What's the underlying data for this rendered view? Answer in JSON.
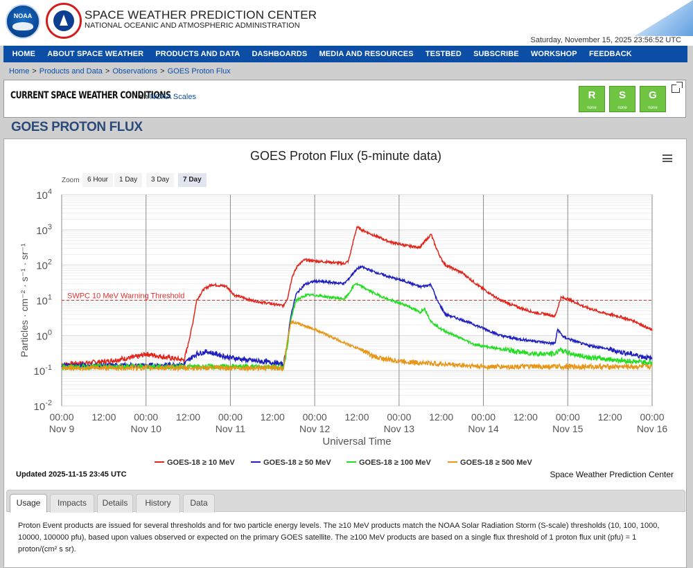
{
  "header": {
    "logo_left": "NOAA",
    "logo_right": "NATIONAL WEATHER SERVICE",
    "title": "SPACE WEATHER PREDICTION CENTER",
    "subtitle": "NATIONAL OCEANIC AND ATMOSPHERIC ADMINISTRATION",
    "datetime": "Saturday, November 15, 2025 23:56:52 UTC"
  },
  "nav": {
    "items": [
      "HOME",
      "ABOUT SPACE WEATHER",
      "PRODUCTS AND DATA",
      "DASHBOARDS",
      "MEDIA AND RESOURCES",
      "TESTBED",
      "SUBSCRIBE",
      "WORKSHOP",
      "FEEDBACK"
    ]
  },
  "breadcrumb": {
    "items": [
      "Home",
      "Products and Data",
      "Observations",
      "GOES Proton Flux"
    ],
    "separator": ">"
  },
  "conditions": {
    "title": "CURRENT SPACE WEATHER CONDITIONS",
    "on_text": "on",
    "link": "NOAA Scales",
    "scales": [
      {
        "letter": "R",
        "value": "none",
        "color": "#6fc442"
      },
      {
        "letter": "S",
        "value": "none",
        "color": "#6fc442"
      },
      {
        "letter": "G",
        "value": "none",
        "color": "#6fc442"
      }
    ]
  },
  "page_title": "GOES PROTON FLUX",
  "zoom": {
    "label": "Zoom",
    "buttons": [
      "6 Hour",
      "1 Day",
      "3 Day",
      "7 Day"
    ],
    "active": "7 Day"
  },
  "chart_data": {
    "type": "line",
    "title": "GOES Proton Flux (5-minute data)",
    "xlabel": "Universal Time",
    "ylabel": "Particles · cm⁻² · s⁻¹ · sr⁻¹",
    "y_scale": "log",
    "ylim": [
      0.01,
      10000
    ],
    "y_ticks": [
      {
        "base": "10",
        "exp": "4"
      },
      {
        "base": "10",
        "exp": "3"
      },
      {
        "base": "10",
        "exp": "2"
      },
      {
        "base": "10",
        "exp": "1"
      },
      {
        "base": "10",
        "exp": "0"
      },
      {
        "base": "10",
        "exp": "-1"
      },
      {
        "base": "10",
        "exp": "-2"
      }
    ],
    "x_range_days": [
      0,
      7
    ],
    "x_ticks": [
      {
        "time": "00:00",
        "day": "Nov 9"
      },
      {
        "time": "12:00",
        "day": ""
      },
      {
        "time": "00:00",
        "day": "Nov 10"
      },
      {
        "time": "12:00",
        "day": ""
      },
      {
        "time": "00:00",
        "day": "Nov 11"
      },
      {
        "time": "12:00",
        "day": ""
      },
      {
        "time": "00:00",
        "day": "Nov 12"
      },
      {
        "time": "12:00",
        "day": ""
      },
      {
        "time": "00:00",
        "day": "Nov 13"
      },
      {
        "time": "12:00",
        "day": ""
      },
      {
        "time": "00:00",
        "day": "Nov 14"
      },
      {
        "time": "12:00",
        "day": ""
      },
      {
        "time": "00:00",
        "day": "Nov 15"
      },
      {
        "time": "12:00",
        "day": ""
      },
      {
        "time": "00:00",
        "day": "Nov 16"
      }
    ],
    "grid": true,
    "legend_position": "bottom",
    "threshold": {
      "label": "SWPC 10 MeV Warning Threshold",
      "value": 10,
      "color": "#e03030"
    },
    "series": [
      {
        "name": "GOES-18 ≥ 10 MeV",
        "color": "#e0261c",
        "points": [
          [
            0,
            0.15
          ],
          [
            0.5,
            0.18
          ],
          [
            0.9,
            0.25
          ],
          [
            1.0,
            0.3
          ],
          [
            1.2,
            0.25
          ],
          [
            1.45,
            0.2
          ],
          [
            1.48,
            0.35
          ],
          [
            1.55,
            2.0
          ],
          [
            1.6,
            10
          ],
          [
            1.68,
            20
          ],
          [
            1.78,
            28
          ],
          [
            1.95,
            25
          ],
          [
            2.05,
            14
          ],
          [
            2.25,
            10
          ],
          [
            2.35,
            9
          ],
          [
            2.55,
            7.5
          ],
          [
            2.63,
            7
          ],
          [
            2.68,
            12
          ],
          [
            2.73,
            45
          ],
          [
            2.8,
            100
          ],
          [
            2.88,
            140
          ],
          [
            3.0,
            130
          ],
          [
            3.2,
            120
          ],
          [
            3.35,
            110
          ],
          [
            3.4,
            130
          ],
          [
            3.45,
            400
          ],
          [
            3.5,
            1200
          ],
          [
            3.56,
            1000
          ],
          [
            3.7,
            700
          ],
          [
            3.9,
            450
          ],
          [
            4.1,
            350
          ],
          [
            4.25,
            320
          ],
          [
            4.33,
            550
          ],
          [
            4.38,
            750
          ],
          [
            4.43,
            350
          ],
          [
            4.5,
            150
          ],
          [
            4.55,
            100
          ],
          [
            4.75,
            60
          ],
          [
            4.95,
            25
          ],
          [
            5.2,
            10
          ],
          [
            5.4,
            6.5
          ],
          [
            5.6,
            4.5
          ],
          [
            5.75,
            4
          ],
          [
            5.85,
            3.5
          ],
          [
            5.88,
            6
          ],
          [
            5.92,
            12
          ],
          [
            6.0,
            11
          ],
          [
            6.2,
            6.5
          ],
          [
            6.4,
            4.5
          ],
          [
            6.6,
            3.5
          ],
          [
            6.8,
            2.5
          ],
          [
            7.0,
            1.4
          ]
        ]
      },
      {
        "name": "GOES-18 ≥ 50 MeV",
        "color": "#1f1fbf",
        "points": [
          [
            0,
            0.14
          ],
          [
            1.0,
            0.14
          ],
          [
            1.45,
            0.15
          ],
          [
            1.5,
            0.2
          ],
          [
            1.6,
            0.3
          ],
          [
            1.72,
            0.35
          ],
          [
            1.95,
            0.25
          ],
          [
            2.2,
            0.2
          ],
          [
            2.5,
            0.17
          ],
          [
            2.63,
            0.15
          ],
          [
            2.67,
            0.5
          ],
          [
            2.72,
            4
          ],
          [
            2.78,
            15
          ],
          [
            2.88,
            28
          ],
          [
            3.0,
            35
          ],
          [
            3.2,
            32
          ],
          [
            3.35,
            30
          ],
          [
            3.4,
            40
          ],
          [
            3.48,
            70
          ],
          [
            3.55,
            90
          ],
          [
            3.7,
            65
          ],
          [
            3.9,
            45
          ],
          [
            4.1,
            33
          ],
          [
            4.25,
            24
          ],
          [
            4.38,
            28
          ],
          [
            4.45,
            10
          ],
          [
            4.55,
            4
          ],
          [
            4.8,
            2.5
          ],
          [
            5.0,
            1.6
          ],
          [
            5.2,
            1.0
          ],
          [
            5.4,
            0.8
          ],
          [
            5.6,
            0.7
          ],
          [
            5.8,
            0.6
          ],
          [
            5.85,
            0.6
          ],
          [
            5.88,
            1.5
          ],
          [
            5.95,
            0.9
          ],
          [
            6.2,
            0.55
          ],
          [
            6.4,
            0.45
          ],
          [
            6.6,
            0.35
          ],
          [
            6.8,
            0.28
          ],
          [
            7.0,
            0.22
          ]
        ]
      },
      {
        "name": "GOES-18 ≥ 100 MeV",
        "color": "#22dd22",
        "points": [
          [
            0,
            0.13
          ],
          [
            1.5,
            0.13
          ],
          [
            2.0,
            0.13
          ],
          [
            2.5,
            0.13
          ],
          [
            2.63,
            0.13
          ],
          [
            2.67,
            0.4
          ],
          [
            2.72,
            3
          ],
          [
            2.78,
            10
          ],
          [
            2.9,
            14
          ],
          [
            3.0,
            14
          ],
          [
            3.2,
            12
          ],
          [
            3.35,
            11
          ],
          [
            3.4,
            15
          ],
          [
            3.48,
            30
          ],
          [
            3.55,
            25
          ],
          [
            3.7,
            16
          ],
          [
            3.9,
            10
          ],
          [
            4.1,
            7
          ],
          [
            4.25,
            4.5
          ],
          [
            4.3,
            6
          ],
          [
            4.38,
            2.5
          ],
          [
            4.5,
            1.5
          ],
          [
            4.7,
            0.9
          ],
          [
            4.9,
            0.55
          ],
          [
            5.1,
            0.45
          ],
          [
            5.3,
            0.38
          ],
          [
            5.5,
            0.32
          ],
          [
            5.7,
            0.3
          ],
          [
            5.85,
            0.3
          ],
          [
            5.9,
            0.4
          ],
          [
            6.0,
            0.32
          ],
          [
            6.2,
            0.25
          ],
          [
            6.4,
            0.22
          ],
          [
            6.6,
            0.2
          ],
          [
            6.8,
            0.18
          ],
          [
            7.0,
            0.17
          ]
        ]
      },
      {
        "name": "GOES-18 ≥ 500 MeV",
        "color": "#e8961a",
        "points": [
          [
            0,
            0.12
          ],
          [
            1.5,
            0.12
          ],
          [
            2.0,
            0.12
          ],
          [
            2.5,
            0.12
          ],
          [
            2.63,
            0.12
          ],
          [
            2.67,
            0.6
          ],
          [
            2.72,
            2.5
          ],
          [
            2.85,
            2
          ],
          [
            3.0,
            1.5
          ],
          [
            3.2,
            0.9
          ],
          [
            3.4,
            0.55
          ],
          [
            3.55,
            0.4
          ],
          [
            3.7,
            0.25
          ],
          [
            3.9,
            0.2
          ],
          [
            4.2,
            0.17
          ],
          [
            4.4,
            0.16
          ],
          [
            4.6,
            0.15
          ],
          [
            4.8,
            0.14
          ],
          [
            5.0,
            0.13
          ],
          [
            5.5,
            0.13
          ],
          [
            6.0,
            0.13
          ],
          [
            6.5,
            0.13
          ],
          [
            7.0,
            0.13
          ]
        ]
      }
    ]
  },
  "footer": {
    "updated": "Updated 2025-11-15 23:45 UTC",
    "credit": "Space Weather Prediction Center"
  },
  "tabs": {
    "items": [
      "Usage",
      "Impacts",
      "Details",
      "History",
      "Data"
    ],
    "active": "Usage",
    "body": "Proton Event products are issued for several thresholds and for two particle energy levels. The ≥10 MeV products match the NOAA Solar Radiation Storm (S-scale) thresholds (10, 100, 1000, 10000, 100000 pfu), based upon values observed or expected on the primary GOES satellite. The ≥100 MeV products are based on a single flux threshold of 1 proton flux unit (pfu) = 1 proton/(cm² s sr)."
  }
}
